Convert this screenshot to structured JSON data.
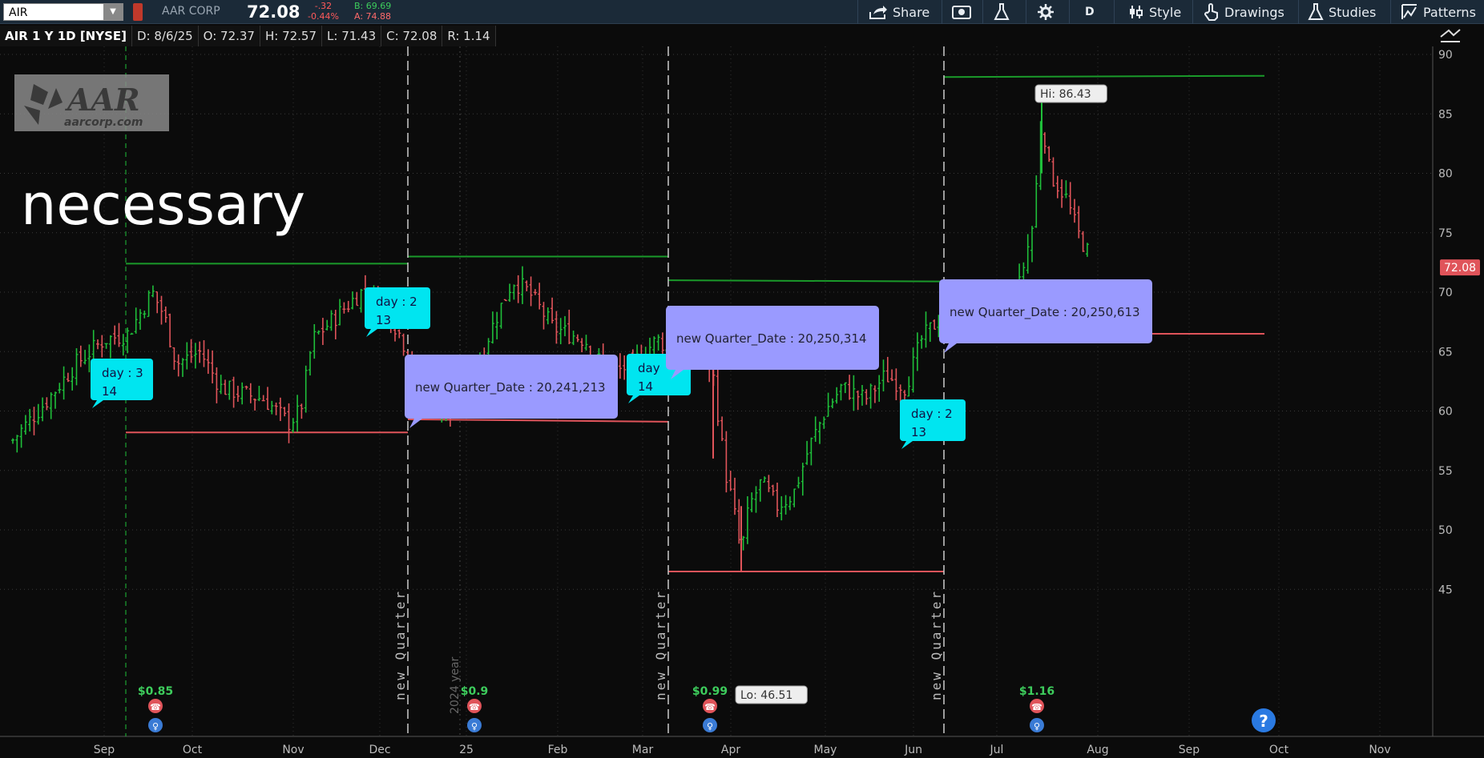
{
  "toolbar": {
    "symbol": "AIR",
    "company": "AAR CORP",
    "last": "72.08",
    "net_change": "-.32",
    "pct_change": "-0.44%",
    "bid": "B: 69.69",
    "ask": "A: 74.88",
    "share_label": "Share",
    "aggregation_label": "D",
    "style_label": "Style",
    "drawings_label": "Drawings",
    "studies_label": "Studies",
    "patterns_label": "Patterns"
  },
  "infobar": {
    "title": "AIR 1 Y 1D [NYSE]",
    "date": "D: 8/6/25",
    "open": "O: 72.37",
    "high": "H: 72.57",
    "low": "L: 71.43",
    "close": "C: 72.08",
    "range": "R: 1.14"
  },
  "overlay": {
    "logo_big": "AAR",
    "logo_small": "aarcorp.com",
    "caption": "necessary"
  },
  "chart_data": {
    "type": "candlestick",
    "ylim": [
      43,
      91
    ],
    "y_ticks": [
      45,
      50,
      55,
      60,
      65,
      70,
      75,
      80,
      85,
      90
    ],
    "x_ticks": [
      "Sep",
      "Oct",
      "Nov",
      "Dec",
      "25",
      "Feb",
      "Mar",
      "Apr",
      "May",
      "Jun",
      "Jul",
      "Aug",
      "Sep",
      "Oct",
      "Nov"
    ],
    "last_price_label": "72.08",
    "high_label": "Hi: 86.43",
    "low_label": "Lo: 46.51",
    "quarter_marker_label": "new Quarter",
    "year_marker_label": "2024 year",
    "day_callouts": [
      {
        "text1": "day  : 3",
        "text2": "14"
      },
      {
        "text1": "day  : 2",
        "text2": "13"
      },
      {
        "text1": "day",
        "text2": "14"
      },
      {
        "text1": "day  : 2",
        "text2": "13"
      }
    ],
    "quarter_callouts": [
      "new Quarter_Date  : 20,241,213",
      "new Quarter_Date  : 20,250,314",
      "new Quarter_Date  : 20,250,613"
    ],
    "dividends": [
      "$0.85",
      "$0.9",
      "$0.99",
      "$1.16"
    ],
    "help_icon": "?",
    "colors": {
      "up": "#1fbf3a",
      "down": "#e0545a",
      "callout_day": "#00e5f0",
      "callout_quarter": "#9a9aff",
      "hi_line": "#1a9a2a",
      "lo_line": "#e0545a"
    }
  }
}
